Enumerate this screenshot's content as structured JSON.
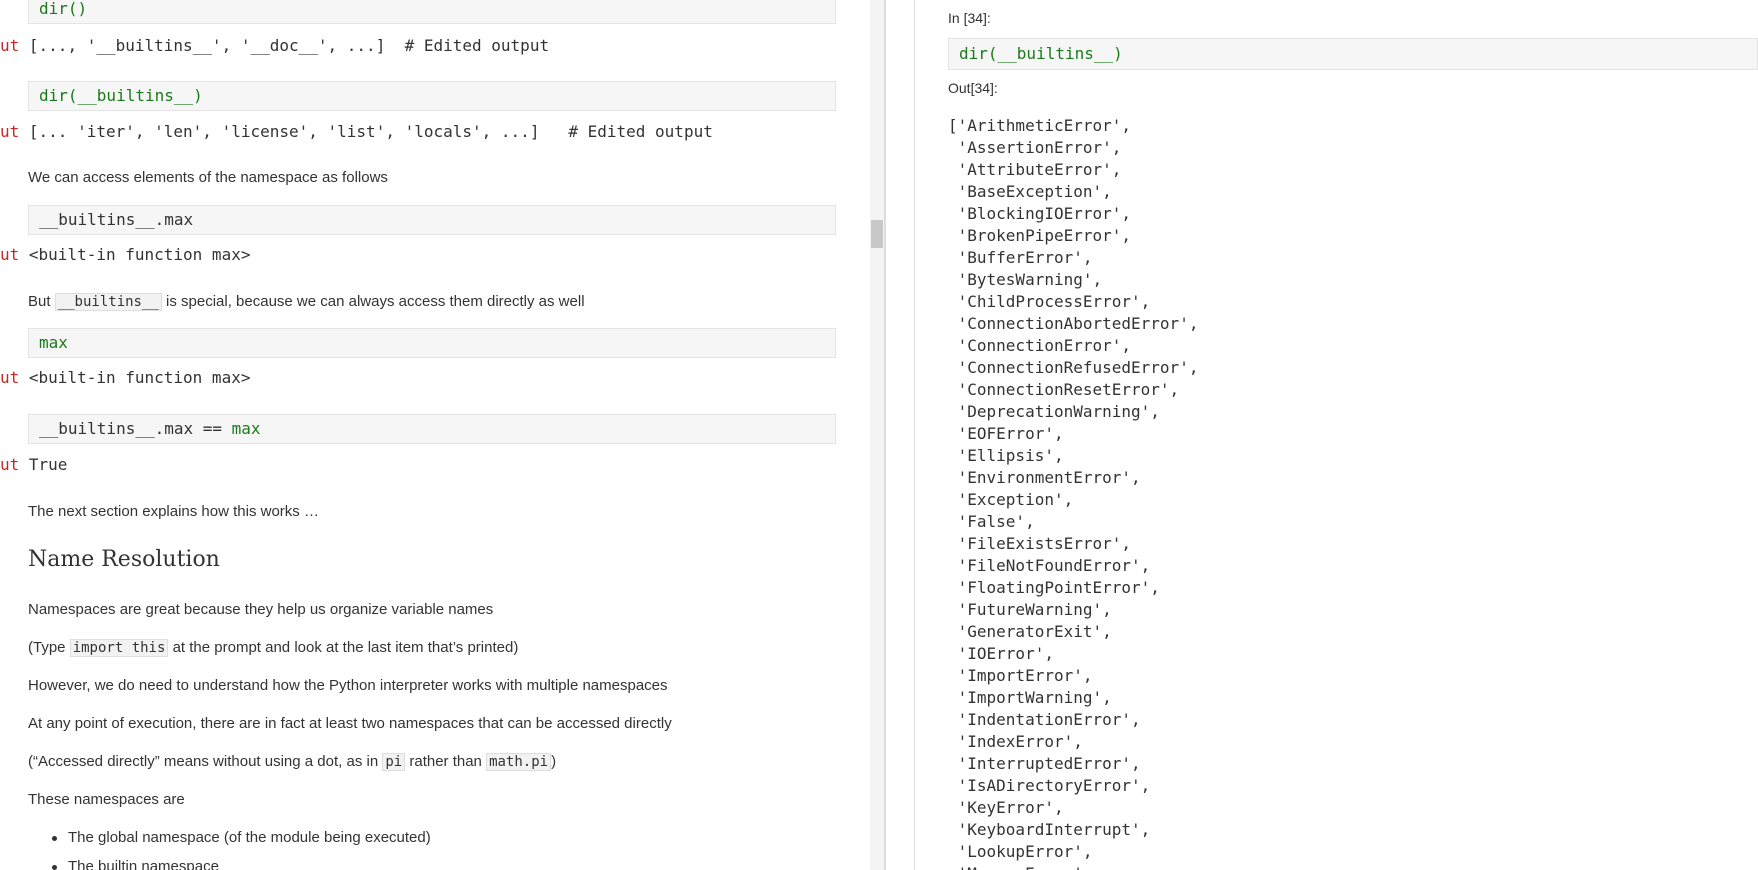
{
  "left": {
    "code1": "dir()",
    "out_prompt": "ut",
    "out1": "[..., '__builtins__', '__doc__', ...]  # Edited output",
    "code2": "dir(__builtins__)",
    "out2": "[... 'iter', 'len', 'license', 'list', 'locals', ...]   # Edited output",
    "p_access": "We can access elements of the namespace as follows",
    "code3": "__builtins__.max",
    "out3": "<built-in function max>",
    "p_but_pre": "But ",
    "p_but_code": "__builtins__",
    "p_but_post": " is special, because we can always access them directly as well",
    "code4": "max",
    "out4": "<built-in function max>",
    "code5_pre": "__builtins__.max == ",
    "code5_kw": "max",
    "out5": "True",
    "p_next": "The next section explains how this works …",
    "heading": "Name Resolution",
    "p_ns_great": "Namespaces are great because they help us organize variable names",
    "p_type_pre": "(Type ",
    "p_type_code": "import this",
    "p_type_post": " at the prompt and look at the last item that’s printed)",
    "p_however": "However, we do need to understand how the Python interpreter works with multiple namespaces",
    "p_atany": "At any point of execution, there are in fact at least two namespaces that can be accessed directly",
    "p_acc_pre": "(“Accessed directly” means without using a dot, as in ",
    "p_acc_code1": "pi",
    "p_acc_mid": " rather than ",
    "p_acc_code2": "math.pi",
    "p_acc_post": ")",
    "p_these": "These namespaces are",
    "bullet1": "The global namespace (of the module being executed)",
    "bullet2": "The builtin namespace"
  },
  "right": {
    "in_prompt": "In [34]:",
    "code": "dir(__builtins__)",
    "out_prompt": "Out[34]:",
    "output_lines": [
      "['ArithmeticError',",
      " 'AssertionError',",
      " 'AttributeError',",
      " 'BaseException',",
      " 'BlockingIOError',",
      " 'BrokenPipeError',",
      " 'BufferError',",
      " 'BytesWarning',",
      " 'ChildProcessError',",
      " 'ConnectionAbortedError',",
      " 'ConnectionError',",
      " 'ConnectionRefusedError',",
      " 'ConnectionResetError',",
      " 'DeprecationWarning',",
      " 'EOFError',",
      " 'Ellipsis',",
      " 'EnvironmentError',",
      " 'Exception',",
      " 'False',",
      " 'FileExistsError',",
      " 'FileNotFoundError',",
      " 'FloatingPointError',",
      " 'FutureWarning',",
      " 'GeneratorExit',",
      " 'IOError',",
      " 'ImportError',",
      " 'ImportWarning',",
      " 'IndentationError',",
      " 'IndexError',",
      " 'InterruptedError',",
      " 'IsADirectoryError',",
      " 'KeyError',",
      " 'KeyboardInterrupt',",
      " 'LookupError',",
      " 'MemoryError',"
    ]
  },
  "colors": {
    "keyword": "#1a7a1a",
    "out_prompt": "#c62828",
    "code_bg": "#f6f6f6"
  }
}
